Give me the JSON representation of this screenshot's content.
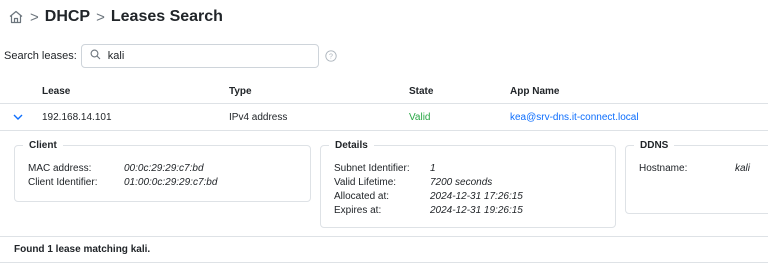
{
  "breadcrumb": {
    "section": "DHCP",
    "page": "Leases Search"
  },
  "search": {
    "label": "Search leases:",
    "value": "kali"
  },
  "table": {
    "columns": [
      "Lease",
      "Type",
      "State",
      "App Name"
    ],
    "row": {
      "lease": "192.168.14.101",
      "type": "IPv4 address",
      "state": "Valid",
      "app_name": "kea@srv-dns.it-connect.local"
    }
  },
  "client": {
    "title": "Client",
    "mac_label": "MAC address:",
    "mac_value": "00:0c:29:29:c7:bd",
    "cid_label": "Client Identifier:",
    "cid_value": "01:00:0c:29:29:c7:bd"
  },
  "details": {
    "title": "Details",
    "subnet_label": "Subnet Identifier:",
    "subnet_value": "1",
    "lifetime_label": "Valid Lifetime:",
    "lifetime_value": "7200 seconds",
    "allocated_label": "Allocated at:",
    "allocated_value": "2024-12-31 17:26:15",
    "expires_label": "Expires at:",
    "expires_value": "2024-12-31 19:26:15"
  },
  "ddns": {
    "title": "DDNS",
    "hostname_label": "Hostname:",
    "hostname_value": "kali"
  },
  "footer": {
    "text": "Found 1 lease matching kali."
  },
  "colors": {
    "valid": "#28a745",
    "link": "#0d6efd",
    "border": "#dee2e6"
  },
  "icons": {
    "home": "home-icon",
    "search": "search-icon",
    "help": "help-circle-icon",
    "expand": "chevron-down-icon"
  }
}
